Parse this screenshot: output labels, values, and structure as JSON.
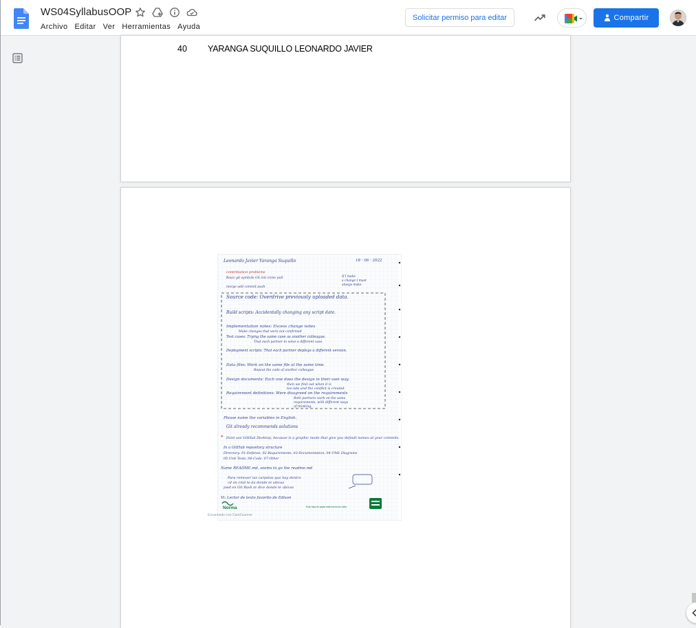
{
  "document": {
    "title": "WS04SyllabusOOP"
  },
  "menu": {
    "items": [
      "Archivo",
      "Editar",
      "Ver",
      "Herramientas",
      "Ayuda"
    ]
  },
  "toolbar": {
    "request_edit_label": "Solicitar permiso para editar",
    "share_label": "Compartir"
  },
  "page1": {
    "row_number": "40",
    "row_name": "YARANGA SUQUILLO LEONARDO JAVIER"
  },
  "scan": {
    "watermark": "Escaneado con CamScanner",
    "handwritten_lines": [
      "Leonardo Javier Yaranga Suquillo",
      "contribution problems",
      "Source code: Overdrive previously uploaded data.",
      "Build scripts: Accidentally changing any script date.",
      "Implementation notes: Excess change notes",
      "Test cases: Trying the same case as another colleague.",
      "Deployment scripts: That each partner deploys a different version.",
      "Data files: Work on the same file at the same time.",
      "Design documents: Each one does the design in their own way.",
      "Requirement definitions: Were disagreed on the requirements",
      "Please name the variables in English.",
      "Git already recommends solutions",
      "Dont use GitHub Desktop, because is a graphic mode that give you default names at your commits.",
      "In a GitHub repository structure",
      "Directory: 01-Defense, 02-Requirements, 03-Documentation, 04-UML Diagrams",
      "05-Unit Tests, 06-Code, 07-Other",
      "Name README.md, seems to go the readme.md",
      "Para remover las carpetas que hay dentro",
      "cd en cmd te da donde te ubicas",
      "pwd en Git Bash te dice donde te ubicas",
      "Vi: Lector de texto favorito de Edison",
      "Norma",
      "Esta hoja de papel está hecha de caña"
    ]
  },
  "icons": {
    "star": "star-icon",
    "move_to_drive": "move-to-drive-icon",
    "info": "info-icon",
    "cloud": "cloud-status-icon",
    "outline": "outline-icon",
    "trend": "activity-dashboard-icon",
    "meet": "google-meet-icon",
    "share_lock": "lock-icon"
  },
  "colors": {
    "accent": "#1a73e8",
    "canvas": "#f1f3f4",
    "page": "#ffffff",
    "ink_blue": "#2a3a8f",
    "ink_red": "#c62828"
  }
}
